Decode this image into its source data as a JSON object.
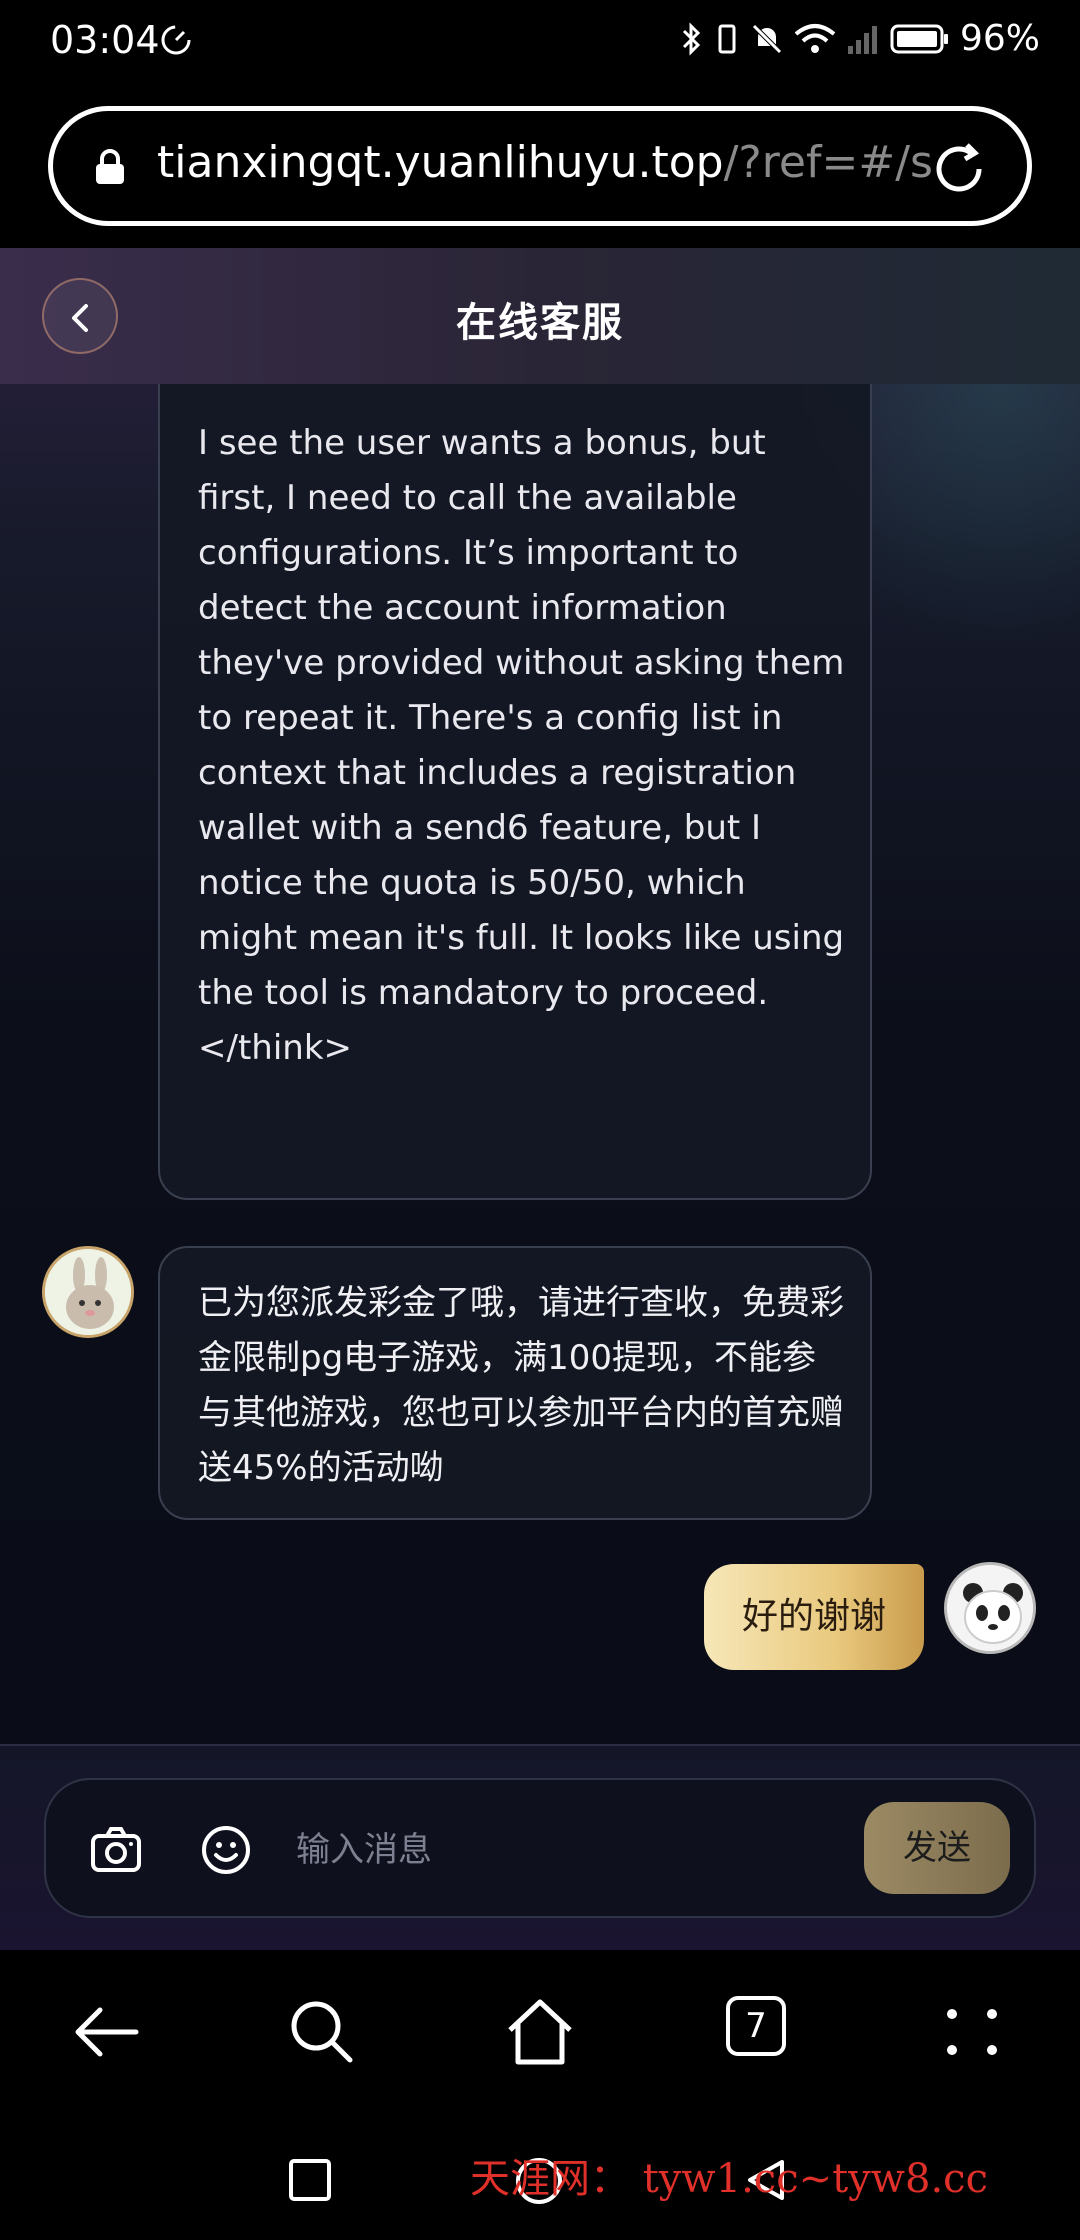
{
  "status_bar": {
    "time": "03:04",
    "battery": "96%"
  },
  "browser": {
    "url_host": "tianxingqt.yuanlihuyu.top",
    "url_rest": "/?ref=#/s"
  },
  "header": {
    "title": "在线客服"
  },
  "messages": [
    {
      "role": "agent",
      "text": "request\n\nI see the user wants a bonus, but first, I need to call the available configurations. It’s important to detect the account information they've provided without asking them to repeat it. There's a config list in context that includes a registration wallet with a send6 feature, but I notice the quota is 50/50, which might mean it's full. It looks like using the tool is mandatory to proceed.\n</think>"
    },
    {
      "role": "agent",
      "text": "已为您派发彩金了哦，请进行查收，免费彩金限制pg电子游戏，满100提现，不能参与其他游戏，您也可以参加平台内的首充赠送45%的活动呦"
    },
    {
      "role": "user",
      "text": "好的谢谢"
    }
  ],
  "composer": {
    "placeholder": "输入消息",
    "send_label": "发送"
  },
  "bottom_bar": {
    "tab_count": "7"
  },
  "watermark": "天涯网： tyw1.cc~tyw8.cc"
}
